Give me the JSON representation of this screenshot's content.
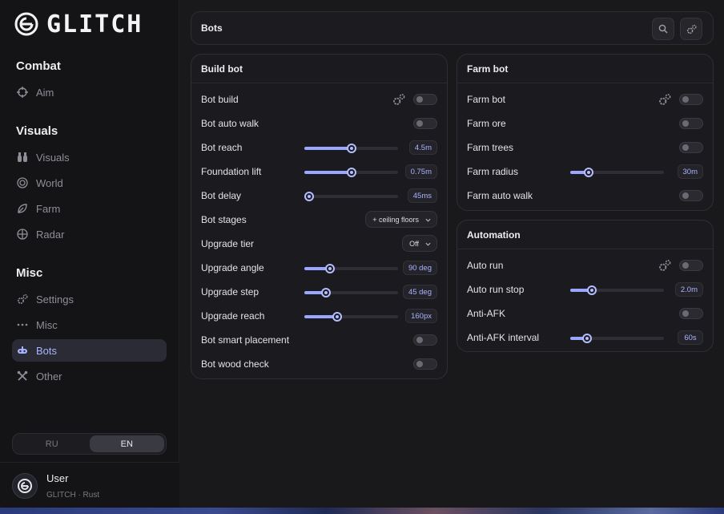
{
  "app": {
    "logo_text": "GLITCH"
  },
  "sidebar": {
    "sections": [
      {
        "title": "Combat",
        "items": [
          {
            "label": "Aim",
            "icon": "crosshair-icon"
          }
        ]
      },
      {
        "title": "Visuals",
        "items": [
          {
            "label": "Visuals",
            "icon": "binoculars-icon"
          },
          {
            "label": "World",
            "icon": "globe-icon"
          },
          {
            "label": "Farm",
            "icon": "leaf-icon"
          },
          {
            "label": "Radar",
            "icon": "radar-icon"
          }
        ]
      },
      {
        "title": "Misc",
        "items": [
          {
            "label": "Settings",
            "icon": "gears-icon"
          },
          {
            "label": "Misc",
            "icon": "dots-icon"
          },
          {
            "label": "Bots",
            "icon": "bot-icon",
            "active": true
          },
          {
            "label": "Other",
            "icon": "tools-icon"
          }
        ]
      }
    ],
    "language": {
      "options": [
        "RU",
        "EN"
      ],
      "selected": "EN"
    },
    "user": {
      "name": "User",
      "subtitle": "GLITCH · Rust"
    }
  },
  "topbar": {
    "title": "Bots",
    "search_icon": "search-icon",
    "settings_icon": "gears-icon"
  },
  "colors": {
    "accent": "#9aa6ff",
    "accent_text": "#aab4ff",
    "active_nav_bg": "#2a2b35"
  },
  "panels": {
    "build_bot": {
      "title": "Build bot",
      "rows": [
        {
          "label": "Bot build",
          "type": "toggle",
          "gear": true,
          "on": false
        },
        {
          "label": "Bot auto walk",
          "type": "toggle",
          "on": false
        },
        {
          "label": "Bot reach",
          "type": "slider",
          "value": "4.5m",
          "level": 0.5
        },
        {
          "label": "Foundation lift",
          "type": "slider",
          "value": "0.75m",
          "level": 0.5
        },
        {
          "label": "Bot delay",
          "type": "slider",
          "value": "45ms",
          "level": 0.05
        },
        {
          "label": "Bot stages",
          "type": "select",
          "value": "+ ceiling floors"
        },
        {
          "label": "Upgrade tier",
          "type": "select",
          "value": "Off"
        },
        {
          "label": "Upgrade angle",
          "type": "slider",
          "value": "90 deg",
          "level": 0.27
        },
        {
          "label": "Upgrade step",
          "type": "slider",
          "value": "45 deg",
          "level": 0.23
        },
        {
          "label": "Upgrade reach",
          "type": "slider",
          "value": "160px",
          "level": 0.35
        },
        {
          "label": "Bot smart placement",
          "type": "toggle",
          "on": false
        },
        {
          "label": "Bot wood check",
          "type": "toggle",
          "on": false
        }
      ]
    },
    "farm_bot": {
      "title": "Farm bot",
      "rows": [
        {
          "label": "Farm bot",
          "type": "toggle",
          "gear": true,
          "on": false
        },
        {
          "label": "Farm ore",
          "type": "toggle",
          "on": false
        },
        {
          "label": "Farm trees",
          "type": "toggle",
          "on": false
        },
        {
          "label": "Farm radius",
          "type": "slider",
          "value": "30m",
          "level": 0.2
        },
        {
          "label": "Farm auto walk",
          "type": "toggle",
          "on": false
        }
      ]
    },
    "automation": {
      "title": "Automation",
      "rows": [
        {
          "label": "Auto run",
          "type": "toggle",
          "gear": true,
          "on": false
        },
        {
          "label": "Auto run stop",
          "type": "slider",
          "value": "2.0m",
          "level": 0.23
        },
        {
          "label": "Anti-AFK",
          "type": "toggle",
          "on": false
        },
        {
          "label": "Anti-AFK interval",
          "type": "slider",
          "value": "60s",
          "level": 0.18
        }
      ]
    }
  }
}
